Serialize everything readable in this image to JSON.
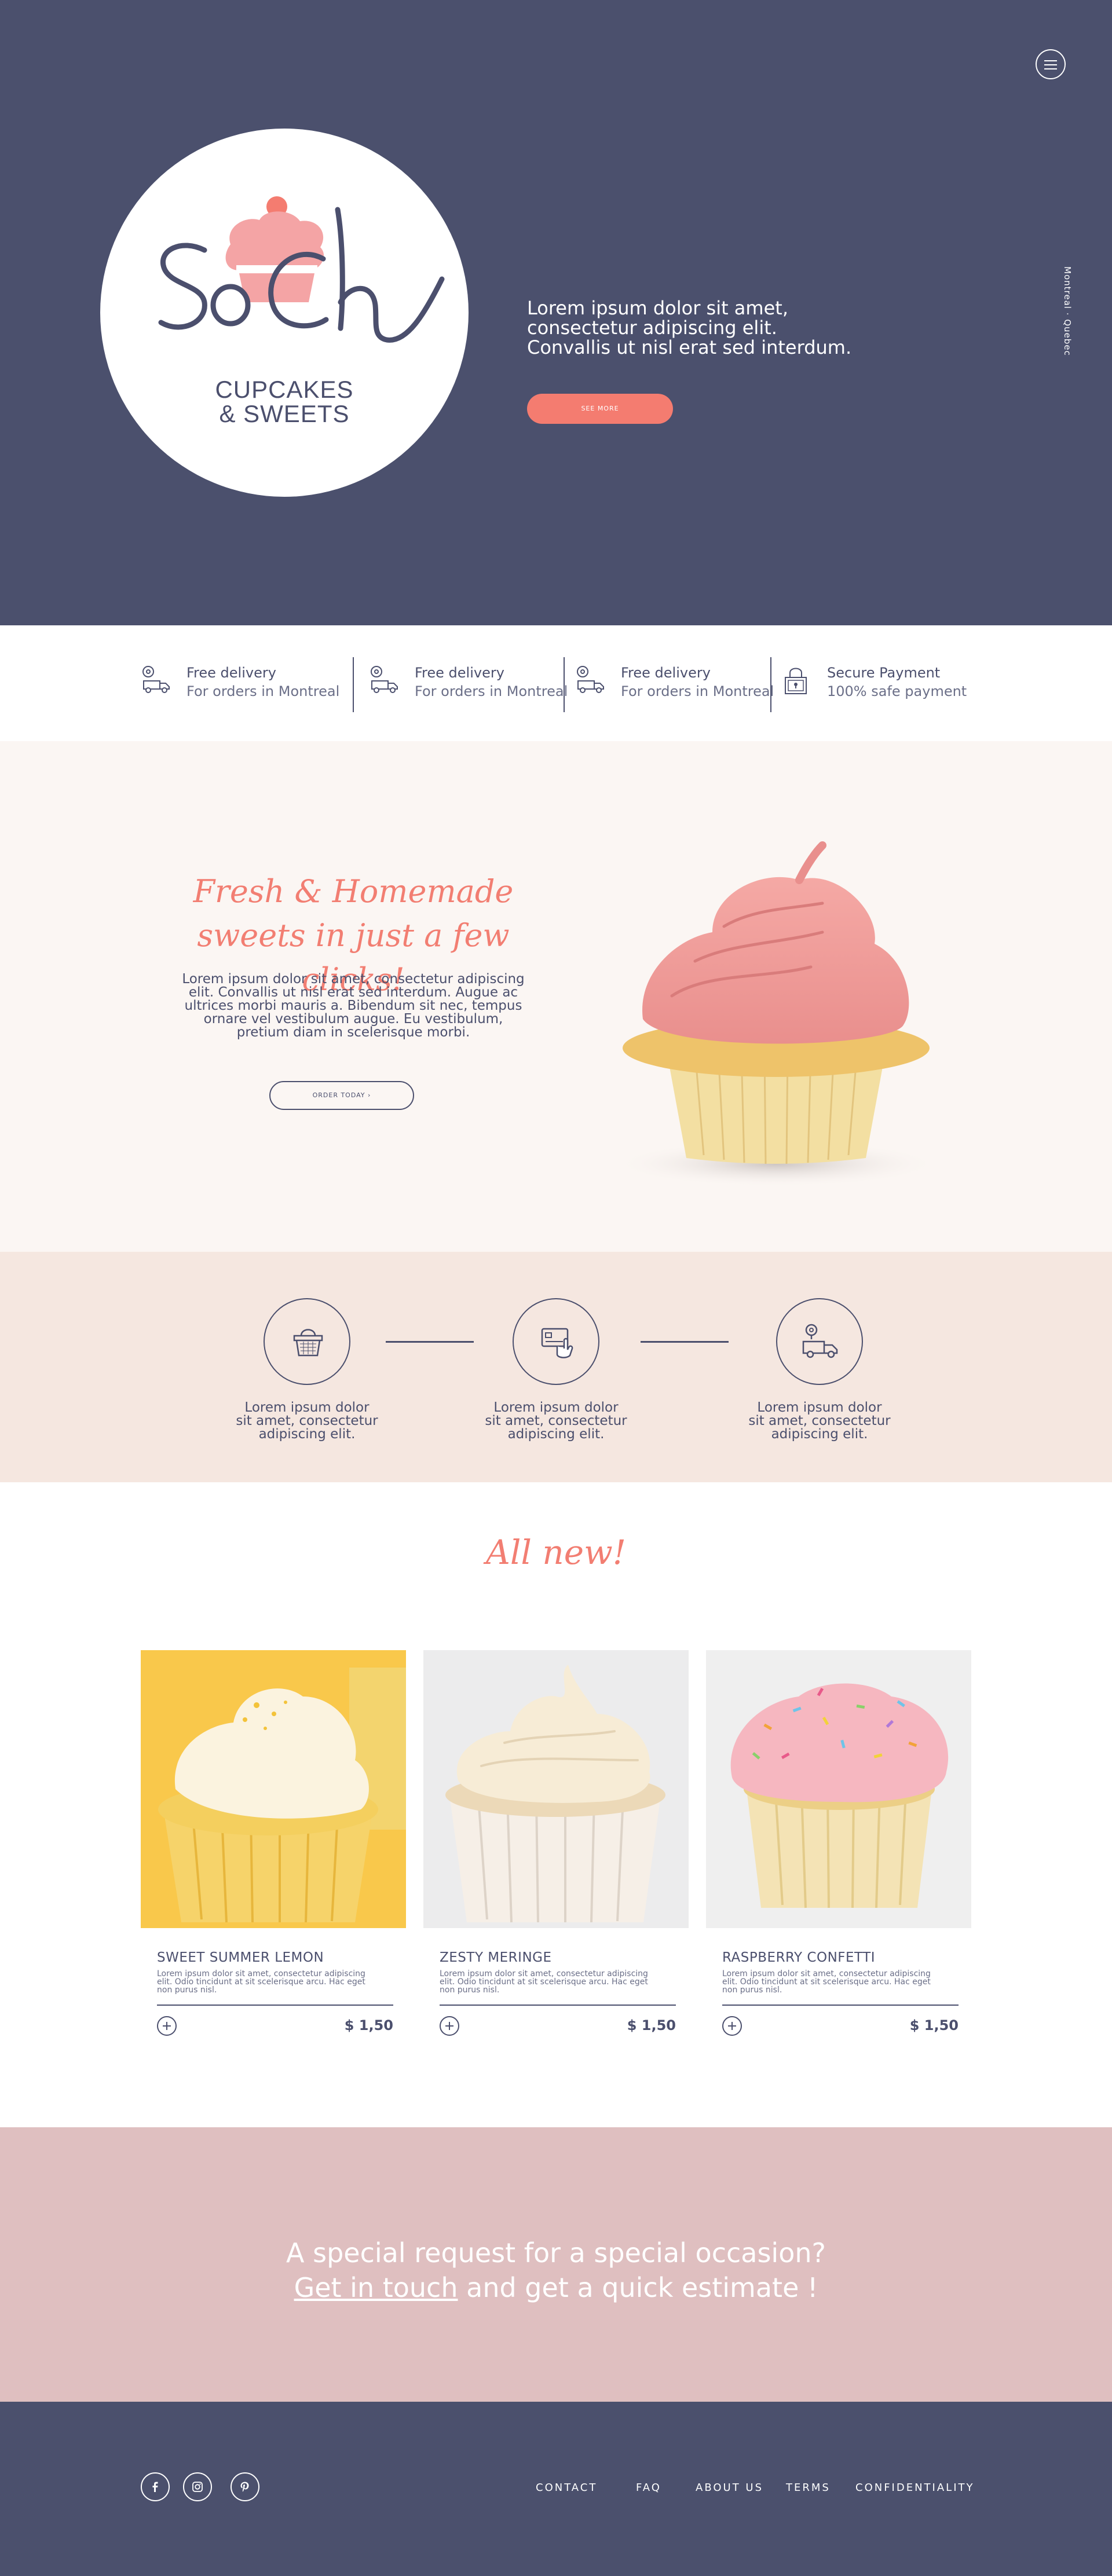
{
  "hero": {
    "logo_word": "SoCh",
    "logo_sub_line1": "CUPCAKES",
    "logo_sub_line2": "& SWEETS",
    "tagline_line1": "Lorem ipsum dolor sit amet,",
    "tagline_line2": "consectetur adipiscing elit.",
    "tagline_line3": "Convallis ut nisl erat sed interdum.",
    "cta_label": "SEE MORE",
    "location": "Montreal · Quebec",
    "menu_icon": "hamburger-icon"
  },
  "features": [
    {
      "title": "Free delivery",
      "sub": "For orders in Montreal",
      "icon": "delivery-truck-icon"
    },
    {
      "title": "Free delivery",
      "sub": "For orders in Montreal",
      "icon": "delivery-truck-icon"
    },
    {
      "title": "Free delivery",
      "sub": "For orders in Montreal",
      "icon": "delivery-truck-icon"
    },
    {
      "title": "Secure Payment",
      "sub": "100% safe payment",
      "icon": "padlock-icon"
    }
  ],
  "fresh": {
    "title_line1": "Fresh & Homemade",
    "title_line2": "sweets in just a few clicks!",
    "body_line1": "Lorem ipsum dolor sit amet, consectetur adipiscing",
    "body_line2": "elit. Convallis ut nisl erat sed interdum. Augue ac",
    "body_line3": "ultrices morbi mauris a. Bibendum sit nec, tempus",
    "body_line4": "ornare vel vestibulum augue. Eu vestibulum,",
    "body_line5": "pretium diam in scelerisque morbi.",
    "cta_label": "ORDER TODAY ›"
  },
  "process": [
    {
      "icon": "basket-icon",
      "line1": "Lorem ipsum dolor",
      "line2": "sit amet, consectetur",
      "line3": "adipiscing elit."
    },
    {
      "icon": "card-payment-icon",
      "line1": "Lorem ipsum dolor",
      "line2": "sit amet, consectetur",
      "line3": "adipiscing elit."
    },
    {
      "icon": "delivery-truck-icon",
      "line1": "Lorem ipsum dolor",
      "line2": "sit amet, consectetur",
      "line3": "adipiscing elit."
    }
  ],
  "allnew": {
    "title": "All new!",
    "products": [
      {
        "name": "SWEET SUMMER LEMON",
        "desc_line1": "Lorem ipsum dolor sit amet, consectetur adipiscing",
        "desc_line2": "elit. Odio tincidunt at sit scelerisque arcu. Hac eget",
        "desc_line3": "non purus nisl.",
        "price": "$ 1,50"
      },
      {
        "name": "ZESTY MERINGE",
        "desc_line1": "Lorem ipsum dolor sit amet, consectetur adipiscing",
        "desc_line2": "elit. Odio tincidunt at sit scelerisque arcu. Hac eget",
        "desc_line3": "non purus nisl.",
        "price": "$ 1,50"
      },
      {
        "name": "RASPBERRY CONFETTI",
        "desc_line1": "Lorem ipsum dolor sit amet, consectetur adipiscing",
        "desc_line2": "elit. Odio tincidunt at sit scelerisque arcu. Hac eget",
        "desc_line3": "non purus nisl.",
        "price": "$ 1,50"
      }
    ]
  },
  "special": {
    "line1": "A special request for a special  occasion?",
    "link_text": "Get in touch",
    "line2_rest": " and get a quick estimate !"
  },
  "footer": {
    "social": [
      "facebook-icon",
      "instagram-icon",
      "pinterest-icon"
    ],
    "nav": [
      "CONTACT",
      "FAQ",
      "ABOUT US",
      "TERMS",
      "CONFIDENTIALITY"
    ]
  },
  "colors": {
    "navy": "#4b506d",
    "coral": "#f47c70",
    "cream": "#fbf6f3",
    "blush": "#f5e7e0",
    "rose": "#dfbfc0"
  }
}
